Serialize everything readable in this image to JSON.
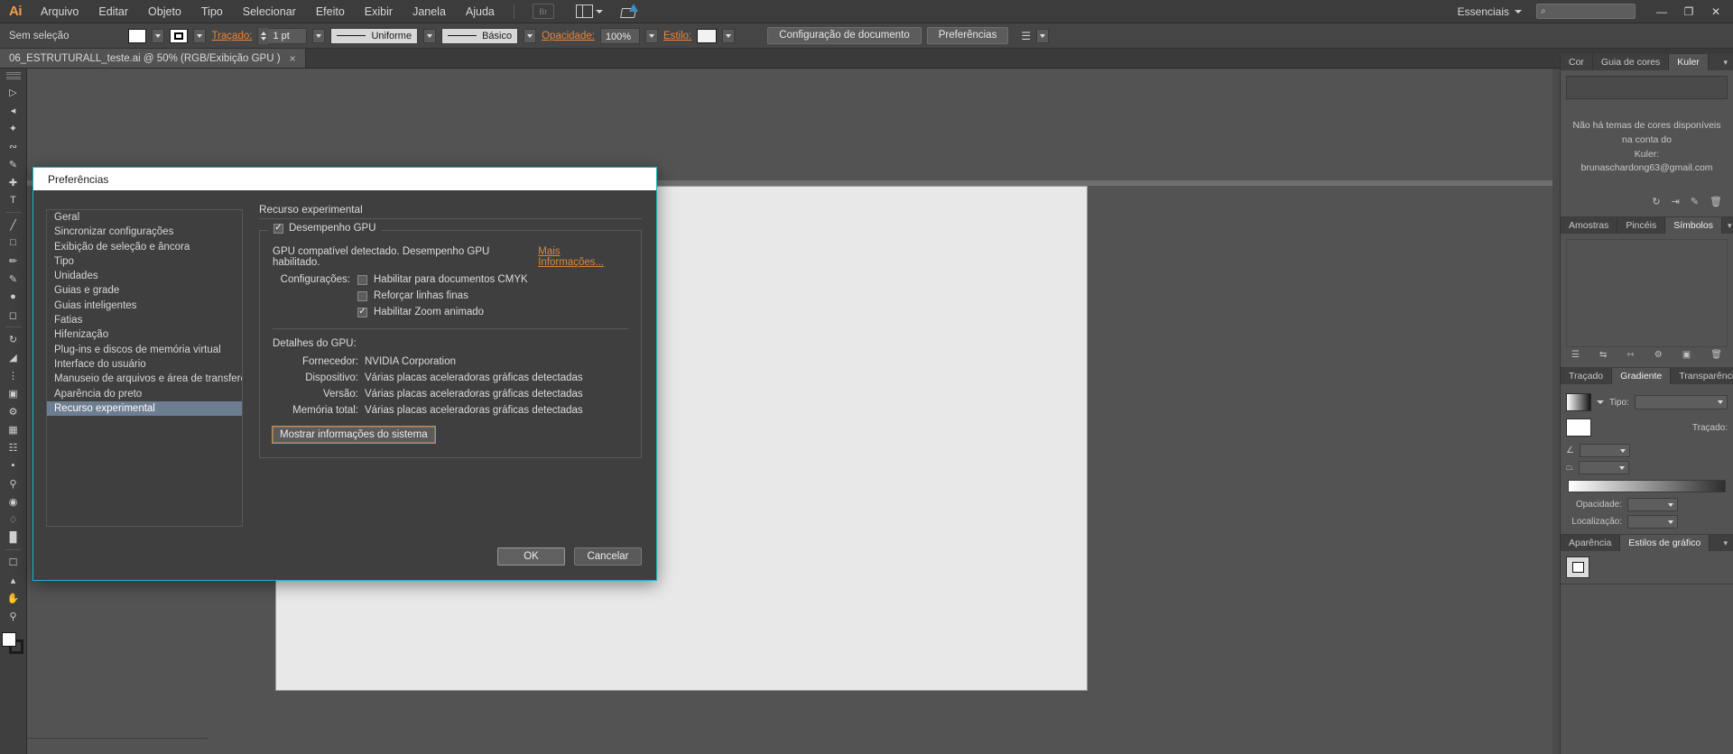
{
  "app": {
    "logo_text": "Ai",
    "menus": [
      "Arquivo",
      "Editar",
      "Objeto",
      "Tipo",
      "Selecionar",
      "Efeito",
      "Exibir",
      "Janela",
      "Ajuda"
    ],
    "bridge_badge": "Br",
    "workspace": "Essenciais",
    "search_placeholder": "",
    "window_buttons": {
      "minimize": "—",
      "maximize": "❐",
      "close": "✕"
    }
  },
  "control_bar": {
    "selection_status": "Sem seleção",
    "stroke_label": "Traçado:",
    "stroke_weight": "1 pt",
    "profile": "Uniforme",
    "brush": "Básico",
    "opacity_label": "Opacidade:",
    "opacity_value": "100%",
    "style_label": "Estilo:",
    "document_setup": "Configuração de documento",
    "preferences": "Preferências"
  },
  "document_tab": {
    "title": "06_ESTRUTURALL_teste.ai @ 50% (RGB/Exibição GPU )",
    "close_glyph": "×"
  },
  "dialog": {
    "title": "Preferências",
    "categories": [
      "Geral",
      "Sincronizar configurações",
      "Exibição de seleção e âncora",
      "Tipo",
      "Unidades",
      "Guias e grade",
      "Guias inteligentes",
      "Fatias",
      "Hifenização",
      "Plug-ins e discos de memória virtual",
      "Interface do usuário",
      "Manuseio de arquivos e área de transferência",
      "Aparência do preto",
      "Recurso experimental"
    ],
    "active_category": "Recurso experimental",
    "pane_title": "Recurso experimental",
    "gpu_group": {
      "legend": "Desempenho GPU",
      "legend_checked": true,
      "status_text": "GPU compatível detectado. Desempenho GPU habilitado.",
      "more_info_link": "Mais Informações...",
      "settings_label": "Configurações:",
      "options": [
        {
          "label": "Habilitar para documentos CMYK",
          "checked": false
        },
        {
          "label": "Reforçar linhas finas",
          "checked": false
        },
        {
          "label": "Habilitar Zoom animado",
          "checked": true
        }
      ],
      "details_title": "Detalhes do GPU:",
      "details": [
        {
          "label": "Fornecedor:",
          "value": "NVIDIA Corporation"
        },
        {
          "label": "Dispositivo:",
          "value": "Várias placas aceleradoras gráficas detectadas"
        },
        {
          "label": "Versão:",
          "value": "Várias placas aceleradoras gráficas detectadas"
        },
        {
          "label": "Memória total:",
          "value": "Várias placas aceleradoras gráficas detectadas"
        }
      ],
      "system_info_button": "Mostrar informações do sistema"
    },
    "ok_button": "OK",
    "cancel_button": "Cancelar",
    "accent_color": "#19b5c4",
    "focus_outline_color": "#d3862f",
    "highlight_color": "#6d7d92"
  },
  "panels": {
    "color_group": {
      "tabs": [
        "Cor",
        "Guia de cores",
        "Kuler"
      ],
      "active_tab": "Kuler",
      "message_line1": "Não há temas de cores disponíveis na conta do",
      "message_line2": "Kuler: brunaschardong63@gmail.com"
    },
    "swatch_group": {
      "tabs": [
        "Amostras",
        "Pincéis",
        "Símbolos"
      ],
      "active_tab": "Símbolos"
    },
    "gradient_group": {
      "tabs": [
        "Traçado",
        "Gradiente",
        "Transparência"
      ],
      "active_tab": "Gradiente",
      "type_label": "Tipo:",
      "stroke_label": "Traçado:",
      "opacity_label": "Opacidade:",
      "location_label": "Localização:"
    },
    "style_group": {
      "tabs": [
        "Aparência",
        "Estilos de gráfico"
      ],
      "active_tab": "Estilos de gráfico"
    }
  },
  "icons": {
    "search": "⌕",
    "check": "✓",
    "menu": "▾"
  }
}
